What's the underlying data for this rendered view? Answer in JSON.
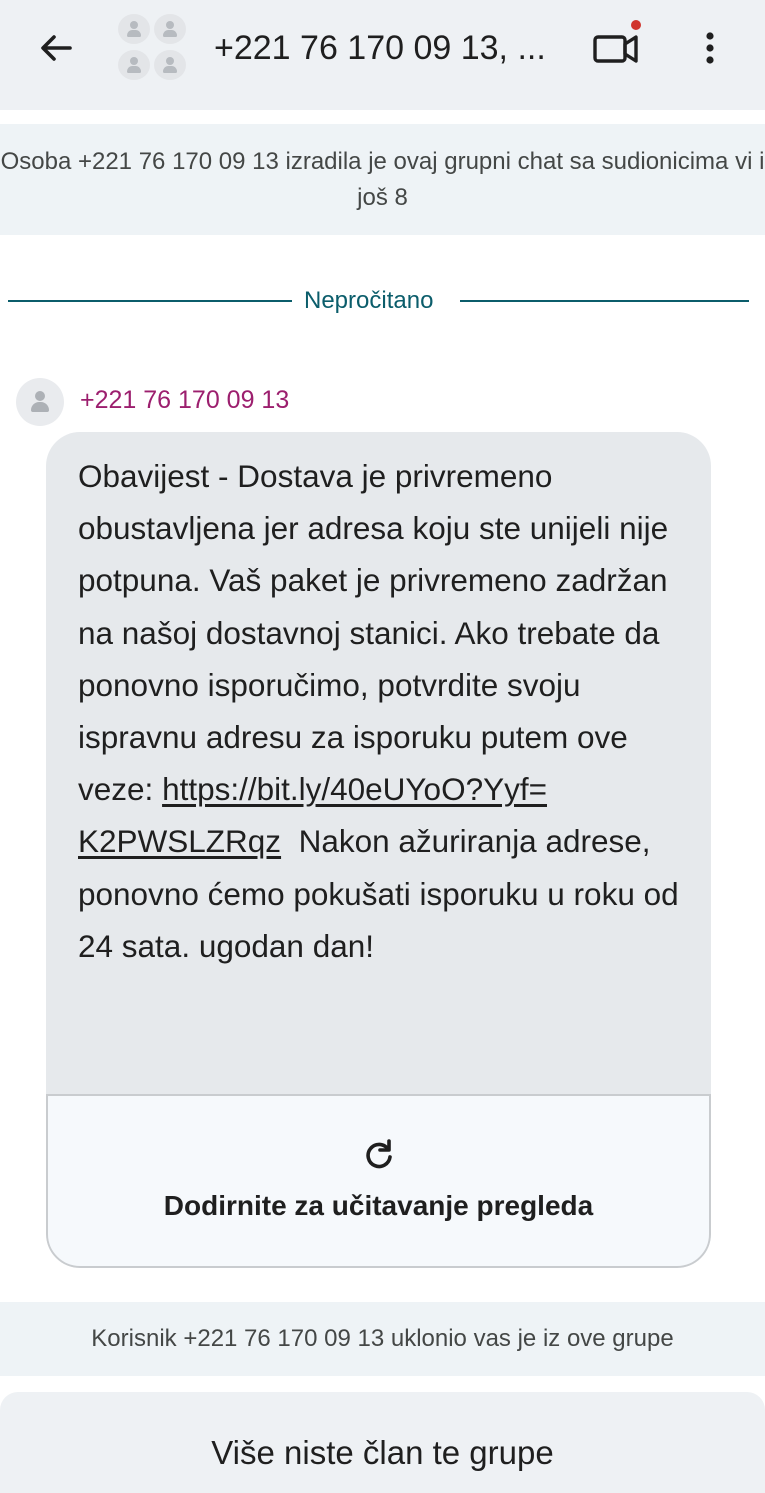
{
  "header": {
    "title": "+221 76 170 09 13, ...",
    "icons": {
      "back": "arrow-back-icon",
      "avatar": "group-avatar-icon",
      "video": "video-call-icon",
      "more": "more-vert-icon"
    },
    "badge_color": "#d0342c"
  },
  "chat": {
    "created_notice": "Osoba +221 76 170 09 13 izradila je ovaj grupni chat sa sudionicima vi i još 8",
    "unread_label": "Nepročitano",
    "message": {
      "sender": "+221 76 170 09 13",
      "text_before_link": "Obavijest - Dostava je privremeno obustavljena jer adresa koju ste unijeli nije potpuna. Vaš paket je privremeno zadržan na našoj dostavnoj stanici. Ako trebate da ponovno isporučimo, potvrdite svoju ispravnu adresu za isporuku putem ove veze:",
      "link_line1": "https://bit.ly/40eUYoO?Yyf=",
      "link_line2": "K2PWSLZRqz",
      "text_after_link": "Nakon ažuriranja adrese, ponovno ćemo pokušati isporuku u roku od 24 sata. ugodan dan!",
      "preview_label": "Dodirnite za učitavanje pregleda"
    },
    "removed_notice": "Korisnik +221 76 170 09 13 uklonio vas je iz ove grupe"
  },
  "footer": {
    "label": "Više niste član te grupe"
  },
  "colors": {
    "accent_teal": "#0b5d6b",
    "sender_name": "#9c1f6e",
    "bubble": "#e6e9ec",
    "topbar": "#eef1f4"
  }
}
